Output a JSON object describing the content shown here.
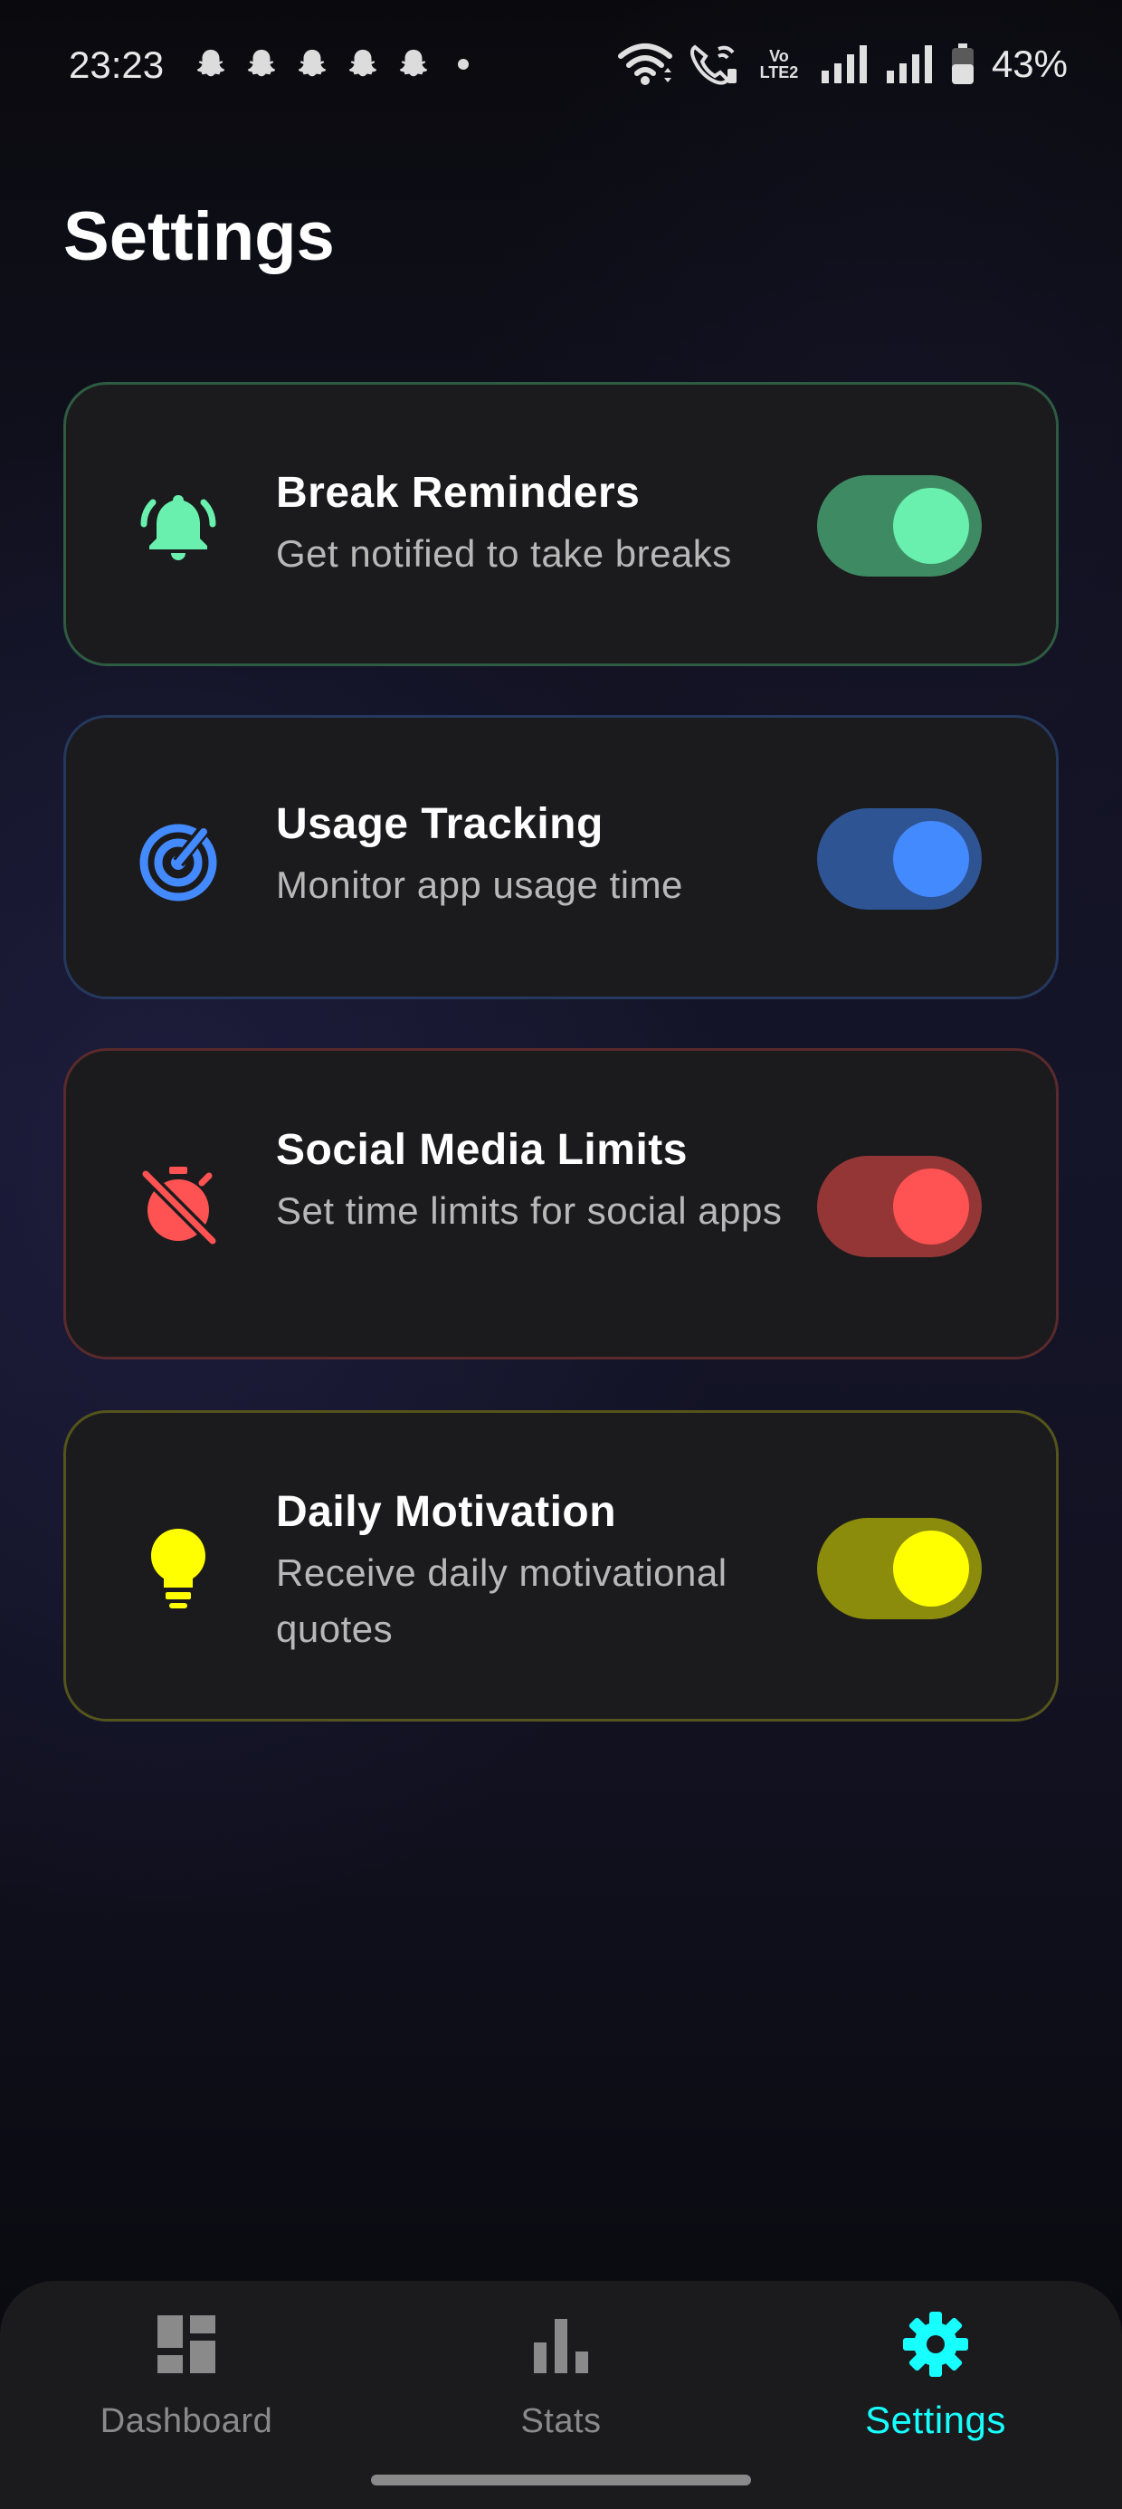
{
  "status_bar": {
    "time": "23:23",
    "lte_label": "Vo LTE2",
    "battery_percent": "43%",
    "notification_icons": [
      "snapchat-icon",
      "snapchat-icon",
      "snapchat-icon",
      "snapchat-icon",
      "snapchat-icon"
    ]
  },
  "page": {
    "title": "Settings"
  },
  "settings": [
    {
      "id": "break-reminders",
      "title": "Break Reminders",
      "subtitle": "Get notified to take breaks",
      "icon": "bell-ringing-icon",
      "enabled": true,
      "accent": "#69f0ae",
      "border": "#2e5c43",
      "track": "#3e8a63"
    },
    {
      "id": "usage-tracking",
      "title": "Usage Tracking",
      "subtitle": "Monitor app usage time",
      "icon": "track-changes-icon",
      "enabled": true,
      "accent": "#448aff",
      "border": "#25385e",
      "track": "#2f5494"
    },
    {
      "id": "social-media-limits",
      "title": "Social Media Limits",
      "subtitle": "Set time limits for social apps",
      "icon": "timer-off-icon",
      "enabled": true,
      "accent": "#ff5252",
      "border": "#5a2a2c",
      "track": "#943636"
    },
    {
      "id": "daily-motivation",
      "title": "Daily Motivation",
      "subtitle": "Receive daily motivational quotes",
      "icon": "lightbulb-icon",
      "enabled": true,
      "accent": "#ffff00",
      "border": "#54541c",
      "track": "#8c8c0c"
    }
  ],
  "bottom_nav": {
    "items": [
      {
        "label": "Dashboard",
        "icon": "dashboard-icon",
        "active": false
      },
      {
        "label": "Stats",
        "icon": "bar-chart-icon",
        "active": false
      },
      {
        "label": "Settings",
        "icon": "gear-icon",
        "active": true
      }
    ],
    "active_color": "#18ffff",
    "inactive_color": "#8a8a8a"
  }
}
